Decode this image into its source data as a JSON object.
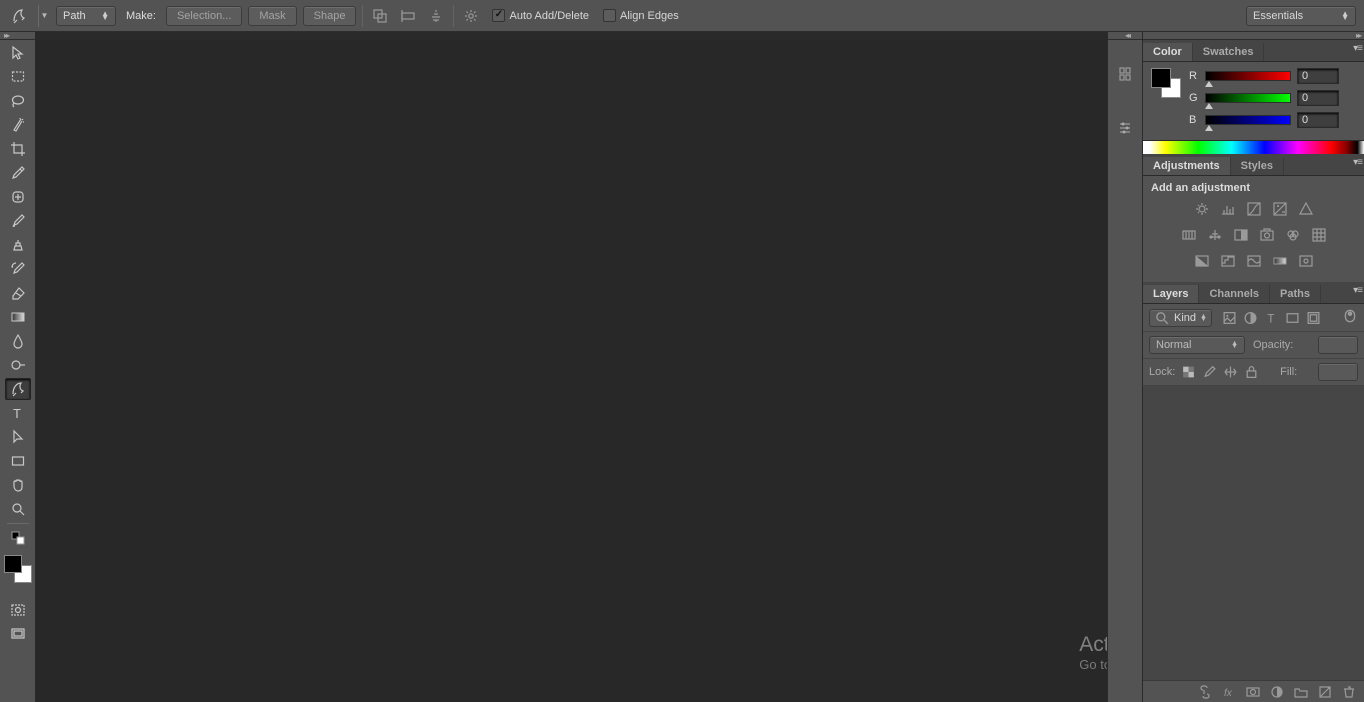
{
  "options": {
    "mode": "Path",
    "make_label": "Make:",
    "selection_btn": "Selection...",
    "mask_btn": "Mask",
    "shape_btn": "Shape",
    "auto_add": "Auto Add/Delete",
    "align_edges": "Align Edges"
  },
  "workspace": "Essentials",
  "panels": {
    "color_tab": "Color",
    "swatches_tab": "Swatches",
    "adjustments_tab": "Adjustments",
    "styles_tab": "Styles",
    "layers_tab": "Layers",
    "channels_tab": "Channels",
    "paths_tab": "Paths"
  },
  "color": {
    "r_label": "R",
    "r_val": "0",
    "g_label": "G",
    "g_val": "0",
    "b_label": "B",
    "b_val": "0"
  },
  "adjustments": {
    "title": "Add an adjustment"
  },
  "layers": {
    "kind": "Kind",
    "blend": "Normal",
    "opacity_label": "Opacity:",
    "lock_label": "Lock:",
    "fill_label": "Fill:"
  },
  "watermark": {
    "title": "Activate Windows",
    "sub": "Go to PC settings to activate Windows."
  }
}
